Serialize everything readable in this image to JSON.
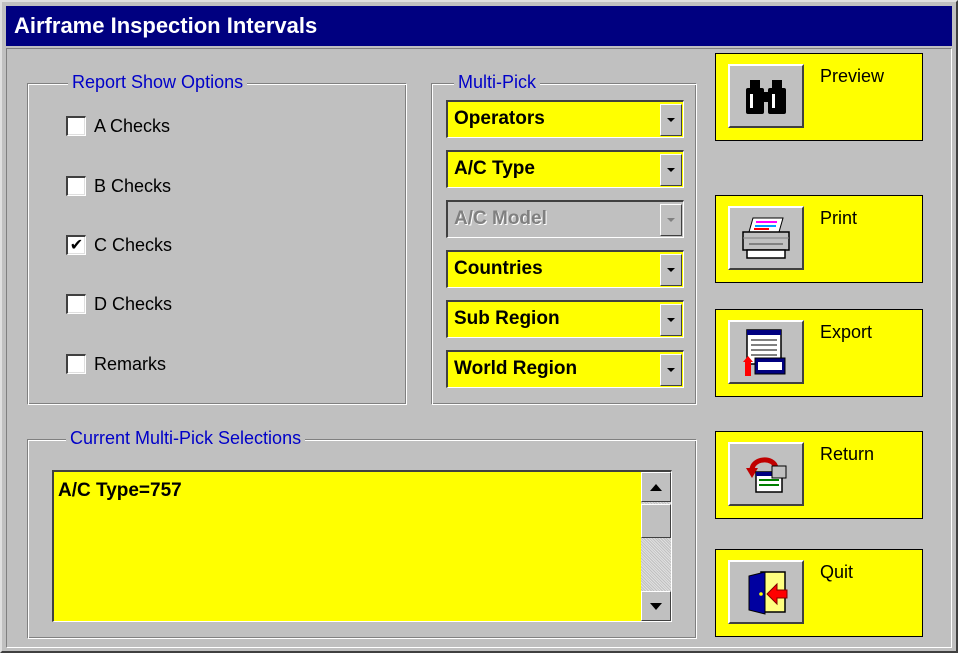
{
  "window": {
    "title": "Airframe Inspection Intervals"
  },
  "report_options": {
    "legend": "Report Show Options",
    "items": [
      {
        "label": "A Checks",
        "checked": false
      },
      {
        "label": "B Checks",
        "checked": false
      },
      {
        "label": "C Checks",
        "checked": true
      },
      {
        "label": "D Checks",
        "checked": false
      },
      {
        "label": "Remarks",
        "checked": false
      }
    ]
  },
  "multipick": {
    "legend": "Multi-Pick",
    "items": [
      {
        "label": "Operators",
        "enabled": true
      },
      {
        "label": "A/C Type",
        "enabled": true
      },
      {
        "label": "A/C Model",
        "enabled": false
      },
      {
        "label": "Countries",
        "enabled": true
      },
      {
        "label": "Sub Region",
        "enabled": true
      },
      {
        "label": "World Region",
        "enabled": true
      }
    ]
  },
  "selections": {
    "legend": "Current Multi-Pick Selections",
    "items": [
      "A/C Type=757"
    ]
  },
  "actions": [
    {
      "label": "Preview",
      "icon": "binoculars-icon"
    },
    {
      "label": "Print",
      "icon": "printer-icon"
    },
    {
      "label": "Export",
      "icon": "export-icon"
    },
    {
      "label": "Return",
      "icon": "return-icon"
    },
    {
      "label": "Quit",
      "icon": "exit-door-icon"
    }
  ],
  "colors": {
    "title_bar": "#000080",
    "field_background": "#ffff00",
    "legend_text": "#0000c8",
    "window_face": "#c0c0c0"
  }
}
